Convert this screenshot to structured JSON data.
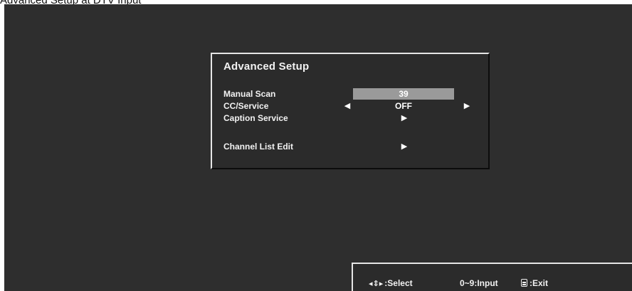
{
  "caption": "Advanced Setup at DTV Input",
  "menu": {
    "title": "Advanced Setup",
    "rows": [
      {
        "label": "Manual Scan",
        "value": "39"
      },
      {
        "label": "CC/Service",
        "value": "OFF"
      },
      {
        "label": "Caption Service"
      },
      {
        "label": "Channel List Edit"
      }
    ]
  },
  "help": {
    "select": ":Select",
    "input": "0~9:Input",
    "exit": ":Exit"
  },
  "icons": {
    "left": "triangle-left",
    "right": "triangle-right",
    "navigate": "four-way-arrows",
    "exit": "exit-remote-icon"
  }
}
